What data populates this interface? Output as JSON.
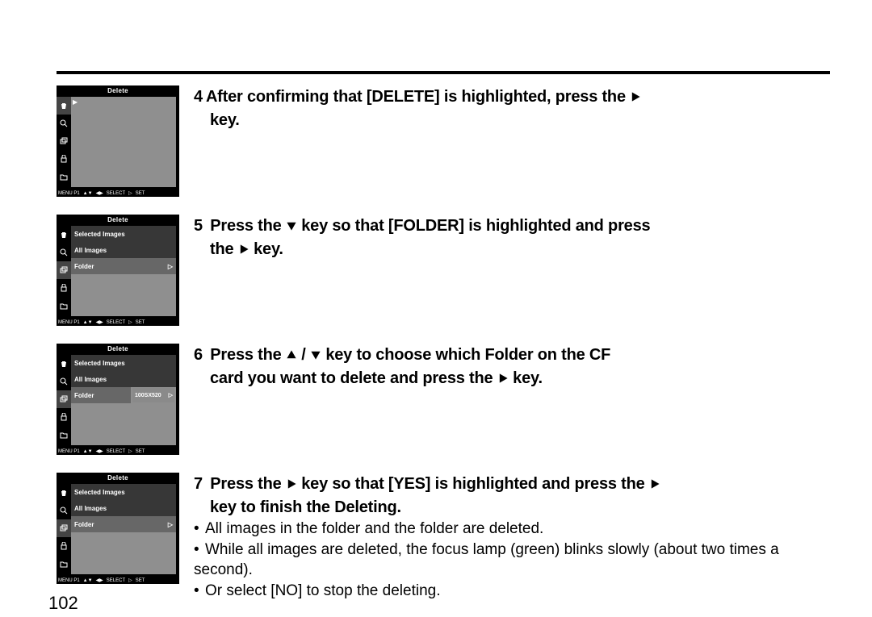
{
  "page_number": "102",
  "lcd": {
    "title": "Delete",
    "footer": {
      "menu": "MENU P1",
      "select": "SELECT",
      "set": "SET"
    },
    "menu_items": {
      "selected_images": "Selected Images",
      "all_images": "All Images",
      "folder": "Folder",
      "folder_alt": "Folder",
      "folder_name": "100SX520"
    }
  },
  "steps": {
    "s4": {
      "num": "4",
      "text_a": "After confirming that [DELETE] is highlighted, press the ",
      "text_b": "key."
    },
    "s5": {
      "num": "5",
      "pre": " Press the ",
      "mid": " key so that [FOLDER] is highlighted and press",
      "line2_a": "the ",
      "line2_b": " key."
    },
    "s6": {
      "num": "6",
      "pre": " Press the ",
      "mid": " key to choose which Folder on the CF",
      "line2_a": "card you want to delete and press the ",
      "line2_b": " key."
    },
    "s7": {
      "num": "7",
      "pre": " Press the ",
      "mid": " key so that [YES] is highlighted and press the ",
      "line2": "key to finish the Deleting."
    }
  },
  "notes": {
    "n1": "All images in the folder and the folder are deleted.",
    "n2": "While all images are deleted, the focus lamp (green) blinks slowly (about two times a second).",
    "n3": "Or select [NO] to stop the deleting."
  }
}
